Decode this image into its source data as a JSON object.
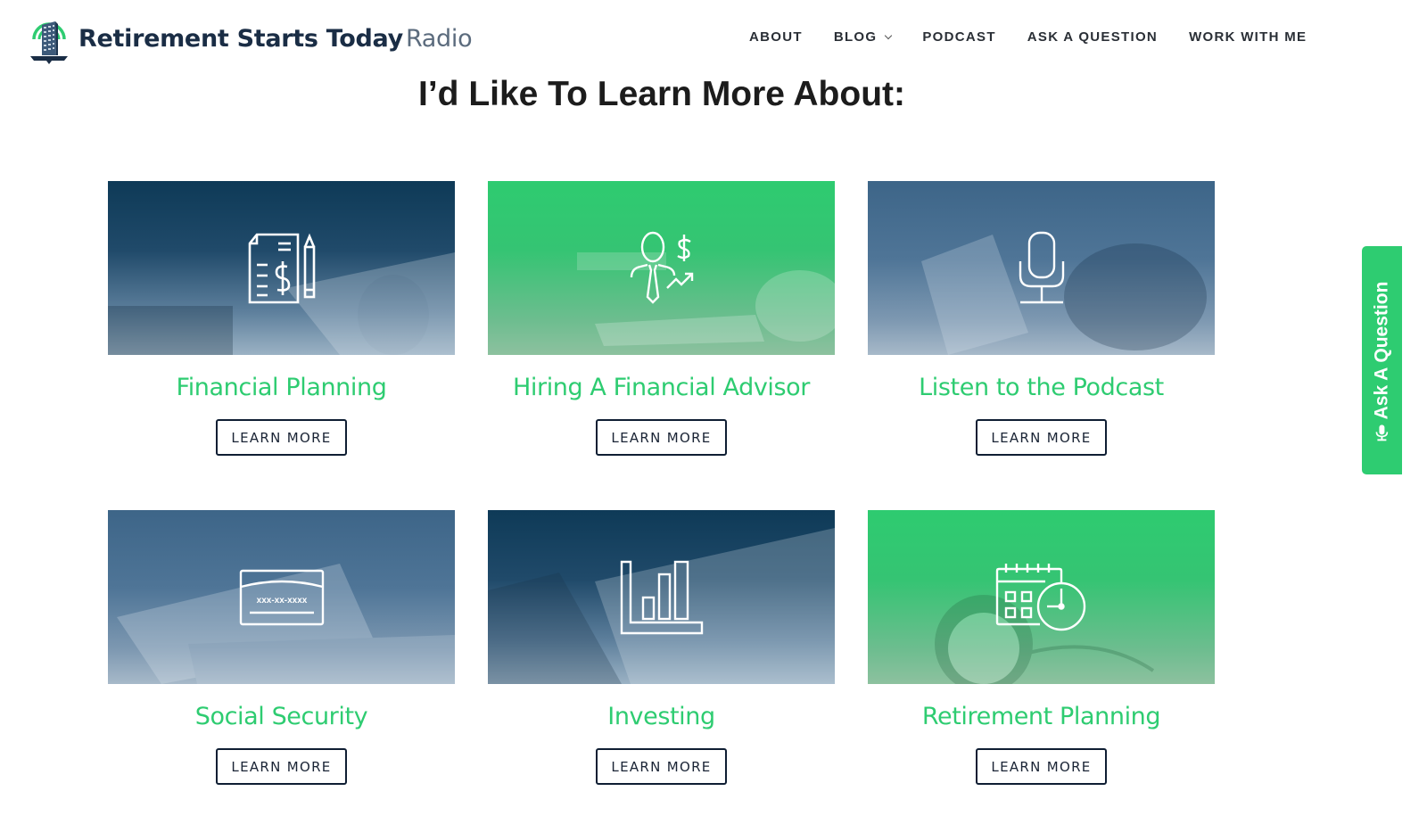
{
  "header": {
    "logo": {
      "bold_text": "Retirement Starts Today",
      "light_text": "Radio"
    },
    "nav": [
      {
        "label": "ABOUT"
      },
      {
        "label": "BLOG",
        "has_dropdown": true
      },
      {
        "label": "PODCAST"
      },
      {
        "label": "ASK A QUESTION"
      },
      {
        "label": "WORK WITH ME"
      }
    ]
  },
  "main": {
    "title_prefix": "I’d Like To ",
    "title_bold": "Learn More",
    "title_suffix": " About:",
    "cards": [
      {
        "title": "Financial Planning",
        "button": "LEARN MORE",
        "icon": "financial-document-icon",
        "theme": "navy"
      },
      {
        "title": "Hiring A Financial Advisor",
        "button": "LEARN MORE",
        "icon": "advisor-icon",
        "theme": "green"
      },
      {
        "title": "Listen to the Podcast",
        "button": "LEARN MORE",
        "icon": "microphone-icon",
        "theme": "blue"
      },
      {
        "title": "Social Security",
        "button": "LEARN MORE",
        "icon": "social-security-card-icon",
        "theme": "blue",
        "icon_text": "xxx-xx-xxxx"
      },
      {
        "title": "Investing",
        "button": "LEARN MORE",
        "icon": "bar-chart-icon",
        "theme": "navy"
      },
      {
        "title": "Retirement Planning",
        "button": "LEARN MORE",
        "icon": "calendar-clock-icon",
        "theme": "green"
      }
    ]
  },
  "side_tab": {
    "label": "Ask A Question",
    "icon": "microphone-icon"
  },
  "colors": {
    "accent_green": "#2ecc71",
    "navy": "#1a2d45"
  }
}
